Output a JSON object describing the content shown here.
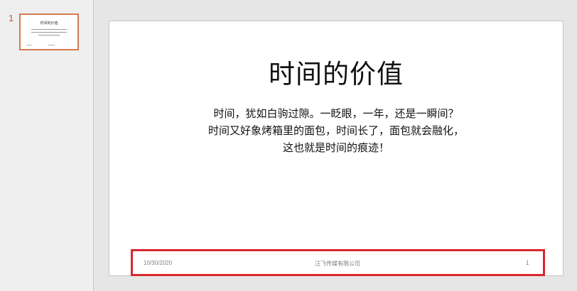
{
  "thumbnails": [
    {
      "number": "1",
      "title": "时间的价值"
    }
  ],
  "slide": {
    "title": "时间的价值",
    "body_lines": [
      "时间，犹如白驹过隙。一眨眼，一年，还是一瞬间？",
      "时间又好象烤箱里的面包，时间长了，面包就会融化，",
      "这也就是时间的痕迹！"
    ],
    "footer": {
      "date": "10/30/2020",
      "company": "汪飞传媒有限公司",
      "page_number": "1"
    }
  },
  "colors": {
    "thumbnail_selected_border": "#d47a55",
    "thumbnail_number": "#c55a2a",
    "footer_highlight": "#d9262e"
  }
}
